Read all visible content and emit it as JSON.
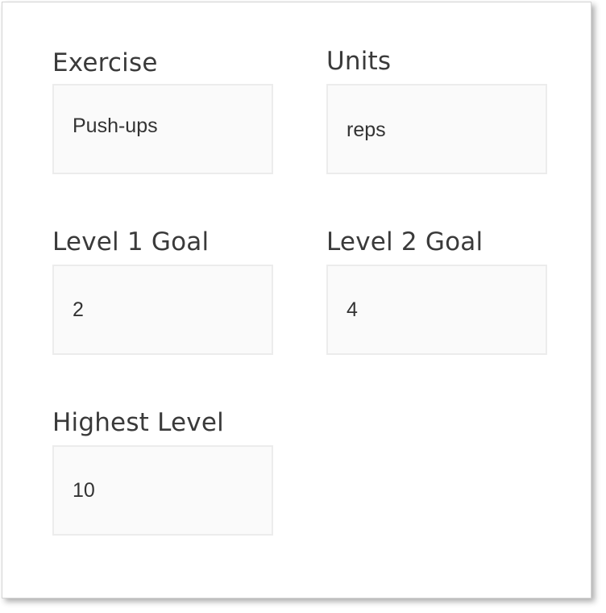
{
  "form": {
    "exercise": {
      "label": "Exercise",
      "value": "Push-ups"
    },
    "units": {
      "label": "Units",
      "value": "reps"
    },
    "level1_goal": {
      "label": "Level 1 Goal",
      "value": "2"
    },
    "level2_goal": {
      "label": "Level 2 Goal",
      "value": "4"
    },
    "highest_level": {
      "label": "Highest Level",
      "value": "10"
    }
  },
  "colors": {
    "label_text": "#3a3a3a",
    "input_background": "#fafafa",
    "input_border": "#ececec",
    "input_text": "#333333"
  }
}
